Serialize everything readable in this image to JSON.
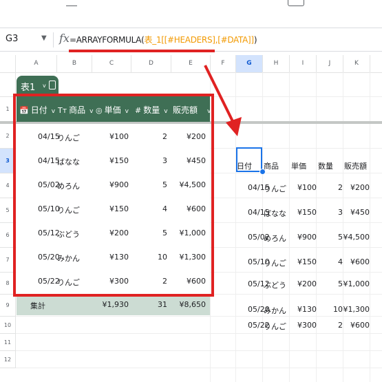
{
  "name_box": "G3",
  "formula": {
    "fn": "=ARRAYFORMULA(",
    "ref1": "表_1[[#HEADERS],[#DATA]]",
    "close": ")"
  },
  "columns": [
    "A",
    "B",
    "C",
    "D",
    "E",
    "F",
    "G",
    "H",
    "I",
    "J",
    "K"
  ],
  "rows": [
    "1",
    "2",
    "3",
    "4",
    "5",
    "6",
    "7",
    "8",
    "9",
    "10",
    "11",
    "12"
  ],
  "table": {
    "name": "表1",
    "headers": [
      {
        "icon": "📅",
        "label": "日付"
      },
      {
        "icon": "Tт",
        "label": "商品"
      },
      {
        "icon": "◎",
        "label": "単価"
      },
      {
        "icon": "#",
        "label": "数量"
      },
      {
        "icon": "",
        "label": "販売額"
      }
    ],
    "rows": [
      [
        "04/15",
        "りんご",
        "¥100",
        "2",
        "¥200"
      ],
      [
        "04/15",
        "ばなな",
        "¥150",
        "3",
        "¥450"
      ],
      [
        "05/02",
        "めろん",
        "¥900",
        "5",
        "¥4,500"
      ],
      [
        "05/10",
        "りんご",
        "¥150",
        "4",
        "¥600"
      ],
      [
        "05/12",
        "ぶどう",
        "¥200",
        "5",
        "¥1,000"
      ],
      [
        "05/20",
        "みかん",
        "¥130",
        "10",
        "¥1,300"
      ],
      [
        "05/22",
        "りんご",
        "¥300",
        "2",
        "¥600"
      ]
    ],
    "totals": {
      "label": "集計",
      "price": "¥1,930",
      "qty": "31",
      "amount": "¥8,650"
    }
  },
  "output": {
    "headers": [
      "日付",
      "商品",
      "単価",
      "数量",
      "販売額"
    ],
    "rows": [
      [
        "04/15",
        "りんご",
        "¥100",
        "2",
        "¥200"
      ],
      [
        "04/15",
        "ばなな",
        "¥150",
        "3",
        "¥450"
      ],
      [
        "05/02",
        "めろん",
        "¥900",
        "5",
        "¥4,500"
      ],
      [
        "05/10",
        "りんご",
        "¥150",
        "4",
        "¥600"
      ],
      [
        "05/12",
        "ぶどう",
        "¥200",
        "5",
        "¥1,000"
      ],
      [
        "05/20",
        "みかん",
        "¥130",
        "10",
        "¥1,300"
      ],
      [
        "05/22",
        "りんご",
        "¥300",
        "2",
        "¥600"
      ]
    ]
  },
  "colors": {
    "table_header": "#3f6f55",
    "totals_row": "#ccdcd3",
    "highlight": "#e02222",
    "selection": "#1a73e8"
  },
  "icons": {
    "function": "fx-icon",
    "dropdown": "chevron-down-icon",
    "table_menu": "table-icon"
  }
}
